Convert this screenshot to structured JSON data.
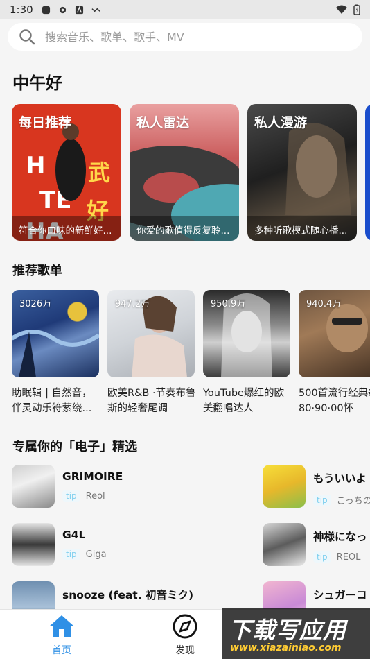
{
  "status_bar": {
    "time": "1:30"
  },
  "search": {
    "placeholder": "搜索音乐、歌单、歌手、MV"
  },
  "greeting": "中午好",
  "feature_cards": [
    {
      "title": "每日推荐",
      "subtitle": "符合你口味的新鲜好..."
    },
    {
      "title": "私人雷达",
      "subtitle": "你爱的歌值得反复聆..."
    },
    {
      "title": "私人漫游",
      "subtitle": "多种听歌模式随心播..."
    }
  ],
  "playlists_section": {
    "title": "推荐歌单",
    "items": [
      {
        "count": "3026万",
        "name": "助眠辑 | 自然音，伴灵动乐符萦绕..."
      },
      {
        "count": "947.2万",
        "name": "欧美R&B ·节奏布鲁斯的轻奢尾调"
      },
      {
        "count": "950.9万",
        "name": "YouTube爆红的欧美翻唱达人"
      },
      {
        "count": "940.4万",
        "name": "500首流行经典歌 | 80·90·00怀"
      }
    ]
  },
  "songs_section": {
    "title": "专属你的「电子」精选",
    "tip_label": "tip",
    "items": [
      {
        "title": "GRIMOIRE",
        "artist": "Reol"
      },
      {
        "title": "G4L",
        "artist": "Giga"
      },
      {
        "title": "snooze (feat. 初音ミク)",
        "artist": ""
      },
      {
        "title": "もういいよ",
        "artist": "こっちの"
      },
      {
        "title": "神様になっ",
        "artist": "REOL"
      },
      {
        "title": "シュガーコ",
        "artist": ""
      }
    ]
  },
  "bottom_nav": {
    "items": [
      {
        "label": "首页",
        "active": true
      },
      {
        "label": "发现",
        "active": false
      }
    ]
  },
  "watermark": {
    "main": "下载写应用",
    "url": "www.xiazainiao.com"
  },
  "colors": {
    "accent": "#2f90e6",
    "tip_text": "#7fd0ef",
    "background": "#f5f5f5"
  }
}
